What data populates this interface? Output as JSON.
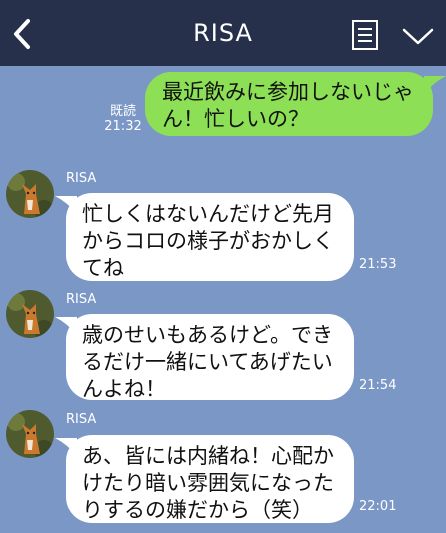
{
  "header": {
    "title": "RISA",
    "back_icon": "chevron-left-icon",
    "menu_icon": "notes-icon",
    "down_icon": "chevron-down-icon",
    "background": "#27304a"
  },
  "chat": {
    "background": "#7b97c5",
    "sent_bubble_color": "#8de055",
    "recv_bubble_color": "#ffffff",
    "messages": [
      {
        "direction": "sent",
        "text": "最近飲みに参加しないじゃ\nん！忙しいの？",
        "read": "既読",
        "time": "21:32"
      },
      {
        "direction": "received",
        "sender": "RISA",
        "text": "忙しくはないんだけど先月\nからコロの様子がおかしく\nてね",
        "time": "21:53"
      },
      {
        "direction": "received",
        "sender": "RISA",
        "text": "歳のせいもあるけど。でき\nるだけ一緒にいてあげたい\nんよね！",
        "time": "21:54"
      },
      {
        "direction": "received",
        "sender": "RISA",
        "text": "あ、皆には内緒ね！心配か\nけたり暗い雰囲気になった\nりするの嫌だから（笑）",
        "time": "22:01"
      }
    ]
  }
}
